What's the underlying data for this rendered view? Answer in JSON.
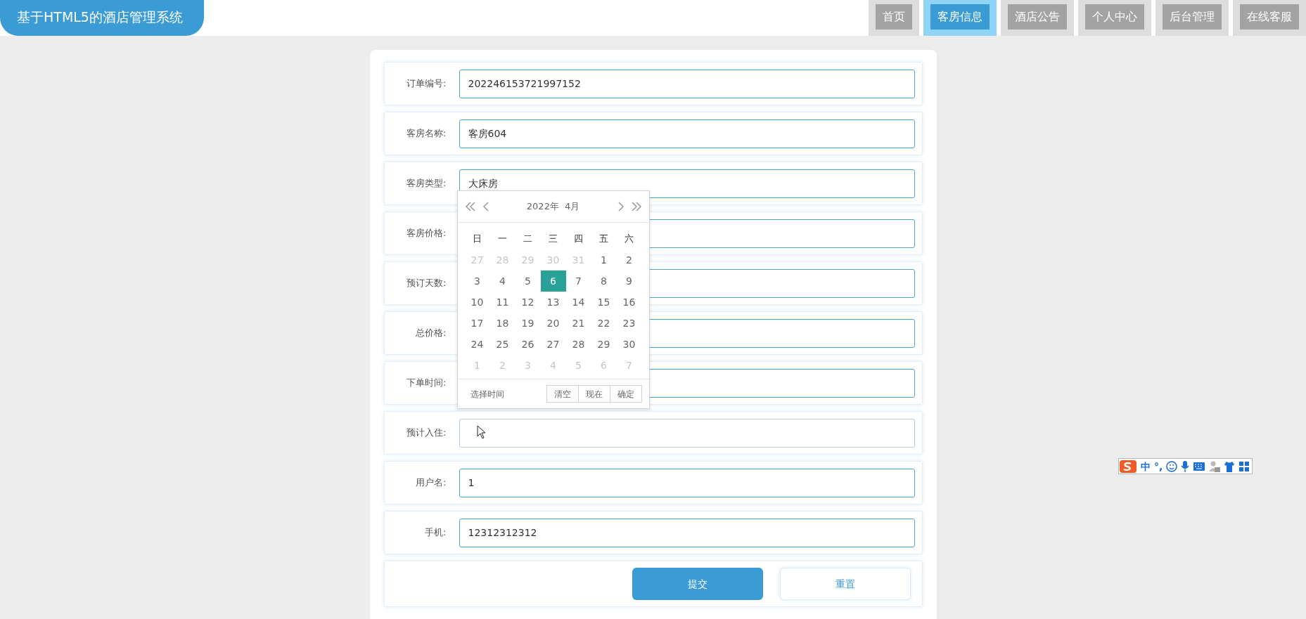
{
  "header": {
    "title": "基于HTML5的酒店管理系统",
    "nav": [
      {
        "label": "首页",
        "selected": false
      },
      {
        "label": "客房信息",
        "selected": true
      },
      {
        "label": "酒店公告",
        "selected": false
      },
      {
        "label": "个人中心",
        "selected": false
      },
      {
        "label": "后台管理",
        "selected": false
      },
      {
        "label": "在线客服",
        "selected": false
      }
    ]
  },
  "form": {
    "fields": [
      {
        "label": "订单编号:",
        "value": "202246153721997152"
      },
      {
        "label": "客房名称:",
        "value": "客房604"
      },
      {
        "label": "客房类型:",
        "value": "大床房"
      },
      {
        "label": "客房价格:"
      },
      {
        "label": "预订天数:"
      },
      {
        "label": "总价格:"
      },
      {
        "label": "下单时间:"
      },
      {
        "label": "预计入住:",
        "focused": true
      },
      {
        "label": "用户名:",
        "value": "1"
      },
      {
        "label": "手机:",
        "value": "12312312312"
      }
    ],
    "buttons": [
      {
        "label": "提交",
        "kind": "primary"
      },
      {
        "label": "重置",
        "kind": "secondary"
      }
    ]
  },
  "date_picker": {
    "year": "2022年",
    "month": "4月",
    "weekdays": [
      "日",
      "一",
      "二",
      "三",
      "四",
      "五",
      "六"
    ],
    "days": [
      {
        "label": "27",
        "in_month": false,
        "selected": false
      },
      {
        "label": "28",
        "in_month": false,
        "selected": false
      },
      {
        "label": "29",
        "in_month": false,
        "selected": false
      },
      {
        "label": "30",
        "in_month": false,
        "selected": false
      },
      {
        "label": "31",
        "in_month": false,
        "selected": false
      },
      {
        "label": "1",
        "in_month": true,
        "selected": false
      },
      {
        "label": "2",
        "in_month": true,
        "selected": false
      },
      {
        "label": "3",
        "in_month": true,
        "selected": false
      },
      {
        "label": "4",
        "in_month": true,
        "selected": false
      },
      {
        "label": "5",
        "in_month": true,
        "selected": false
      },
      {
        "label": "6",
        "in_month": true,
        "selected": true
      },
      {
        "label": "7",
        "in_month": true,
        "selected": false
      },
      {
        "label": "8",
        "in_month": true,
        "selected": false
      },
      {
        "label": "9",
        "in_month": true,
        "selected": false
      },
      {
        "label": "10",
        "in_month": true,
        "selected": false
      },
      {
        "label": "11",
        "in_month": true,
        "selected": false
      },
      {
        "label": "12",
        "in_month": true,
        "selected": false
      },
      {
        "label": "13",
        "in_month": true,
        "selected": false
      },
      {
        "label": "14",
        "in_month": true,
        "selected": false
      },
      {
        "label": "15",
        "in_month": true,
        "selected": false
      },
      {
        "label": "16",
        "in_month": true,
        "selected": false
      },
      {
        "label": "17",
        "in_month": true,
        "selected": false
      },
      {
        "label": "18",
        "in_month": true,
        "selected": false
      },
      {
        "label": "19",
        "in_month": true,
        "selected": false
      },
      {
        "label": "20",
        "in_month": true,
        "selected": false
      },
      {
        "label": "21",
        "in_month": true,
        "selected": false
      },
      {
        "label": "22",
        "in_month": true,
        "selected": false
      },
      {
        "label": "23",
        "in_month": true,
        "selected": false
      },
      {
        "label": "24",
        "in_month": true,
        "selected": false
      },
      {
        "label": "25",
        "in_month": true,
        "selected": false
      },
      {
        "label": "26",
        "in_month": true,
        "selected": false
      },
      {
        "label": "27",
        "in_month": true,
        "selected": false
      },
      {
        "label": "28",
        "in_month": true,
        "selected": false
      },
      {
        "label": "29",
        "in_month": true,
        "selected": false
      },
      {
        "label": "30",
        "in_month": true,
        "selected": false
      },
      {
        "label": "1",
        "in_month": false,
        "selected": false
      },
      {
        "label": "2",
        "in_month": false,
        "selected": false
      },
      {
        "label": "3",
        "in_month": false,
        "selected": false
      },
      {
        "label": "4",
        "in_month": false,
        "selected": false
      },
      {
        "label": "5",
        "in_month": false,
        "selected": false
      },
      {
        "label": "6",
        "in_month": false,
        "selected": false
      },
      {
        "label": "7",
        "in_month": false,
        "selected": false
      }
    ],
    "footer_label": "选择时间",
    "buttons": [
      "清空",
      "现在",
      "确定"
    ]
  },
  "ime_toolbar": {
    "mode": "中",
    "punctuation": "°,"
  }
}
